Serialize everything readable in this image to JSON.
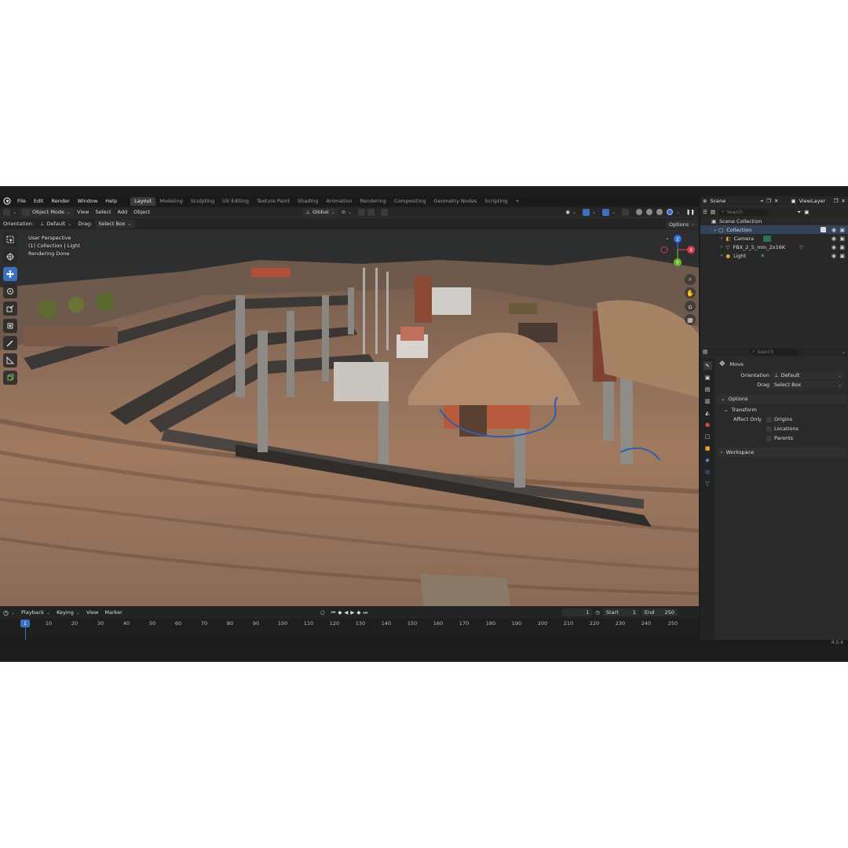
{
  "menu": {
    "items": [
      "File",
      "Edit",
      "Render",
      "Window",
      "Help"
    ],
    "workspaces": [
      "Layout",
      "Modeling",
      "Sculpting",
      "UV Editing",
      "Texture Paint",
      "Shading",
      "Animation",
      "Rendering",
      "Compositing",
      "Geometry Nodes",
      "Scripting"
    ],
    "active_workspace": "Layout",
    "add_tab": "+"
  },
  "viewport_header": {
    "mode": "Object Mode",
    "menus": [
      "View",
      "Select",
      "Add",
      "Object"
    ],
    "transform_orientation": "Global",
    "orientation_label": "Orientation:",
    "orientation_value": "Default",
    "drag_label": "Drag:",
    "drag_value": "Select Box",
    "options": "Options"
  },
  "viewport_info": {
    "line1": "User Perspective",
    "line2": "(1) Collection | Light",
    "line3": "Rendering Done"
  },
  "gizmo": {
    "x": "X",
    "y": "Y",
    "z": "Z"
  },
  "scene": {
    "name": "Scene",
    "view_layer": "ViewLayer"
  },
  "outliner": {
    "search_placeholder": "Search",
    "scene_collection": "Scene Collection",
    "collection": "Collection",
    "items": [
      "Camera",
      "FBX_2_5_min_2x16K",
      "Light"
    ]
  },
  "properties": {
    "search_placeholder": "Search",
    "tool_name": "Move",
    "orientation_label": "Orientation",
    "orientation_value": "Default",
    "drag_label": "Drag",
    "drag_value": "Select Box",
    "options_section": "Options",
    "transform_section": "Transform",
    "affect_only_label": "Affect Only",
    "affect_options": [
      "Origins",
      "Locations",
      "Parents"
    ],
    "workspace_section": "Workspace"
  },
  "timeline": {
    "menus": [
      "Playback",
      "Keying",
      "View",
      "Marker"
    ],
    "current_frame": "1",
    "start_label": "Start",
    "start_value": "1",
    "end_label": "End",
    "end_value": "250",
    "ticks": [
      "10",
      "20",
      "30",
      "40",
      "50",
      "60",
      "70",
      "80",
      "90",
      "100",
      "110",
      "120",
      "130",
      "140",
      "150",
      "160",
      "170",
      "180",
      "190",
      "200",
      "210",
      "220",
      "230",
      "240",
      "250"
    ]
  },
  "status": {
    "version": "4.5.4"
  },
  "colors": {
    "accent": "#3d6fbf",
    "ground": "#8a6a52",
    "sky": "#2f3031"
  }
}
